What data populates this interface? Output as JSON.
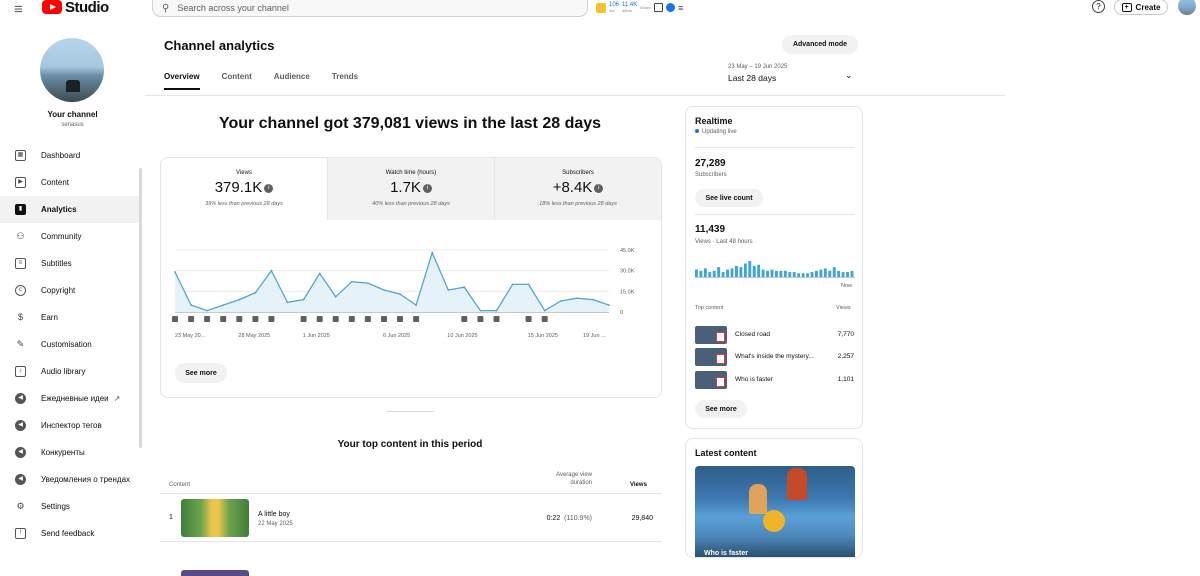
{
  "topbar": {
    "logo_text": "Studio",
    "search_placeholder": "Search across your channel",
    "ext_stat1": "106",
    "ext_stat1_sub": "1hr",
    "ext_stat2": "11.4K",
    "ext_stat2_sub": "48hrs",
    "ext_stat3_sub": "60sec",
    "create_label": "Create"
  },
  "sidebar": {
    "channel_name": "Your channel",
    "channel_handle": "senasus",
    "items": [
      {
        "label": "Dashboard",
        "icon": "dashboard-icon"
      },
      {
        "label": "Content",
        "icon": "content-icon"
      },
      {
        "label": "Analytics",
        "icon": "analytics-icon"
      },
      {
        "label": "Community",
        "icon": "community-icon"
      },
      {
        "label": "Subtitles",
        "icon": "subtitles-icon"
      },
      {
        "label": "Copyright",
        "icon": "copyright-icon"
      },
      {
        "label": "Earn",
        "icon": "earn-icon"
      },
      {
        "label": "Customisation",
        "icon": "customisation-icon"
      },
      {
        "label": "Audio library",
        "icon": "audio-library-icon"
      },
      {
        "label": "Ежедневные идеи",
        "icon": "extension-icon"
      },
      {
        "label": "Инспектор тегов",
        "icon": "extension-icon"
      },
      {
        "label": "Конкуренты",
        "icon": "extension-icon"
      },
      {
        "label": "Уведомления о трендах",
        "icon": "extension-icon"
      },
      {
        "label": "Settings",
        "icon": "settings-icon"
      },
      {
        "label": "Send feedback",
        "icon": "feedback-icon"
      }
    ]
  },
  "header": {
    "title": "Channel analytics",
    "advanced_mode": "Advanced mode",
    "tabs": [
      "Overview",
      "Content",
      "Audience",
      "Trends"
    ],
    "date_range": "23 May – 19 Jun 2025",
    "period": "Last 28 days"
  },
  "overview": {
    "headline": "Your channel got 379,081 views in the last 28 days",
    "metrics": [
      {
        "label": "Views",
        "value": "379.1K",
        "note": "39% less than previous 28 days"
      },
      {
        "label": "Watch time (hours)",
        "value": "1.7K",
        "note": "40% less than previous 28 days"
      },
      {
        "label": "Subscribers",
        "value": "+8.4K",
        "note": "18% less than previous 28 days"
      }
    ],
    "see_more": "See more"
  },
  "chart_data": {
    "type": "area",
    "x": [
      "23 May",
      "24 May",
      "25 May",
      "26 May",
      "27 May",
      "28 May",
      "29 May",
      "30 May",
      "31 May",
      "1 Jun",
      "2 Jun",
      "3 Jun",
      "4 Jun",
      "5 Jun",
      "6 Jun",
      "7 Jun",
      "8 Jun",
      "9 Jun",
      "10 Jun",
      "11 Jun",
      "12 Jun",
      "13 Jun",
      "14 Jun",
      "15 Jun",
      "16 Jun",
      "17 Jun",
      "18 Jun",
      "19 Jun"
    ],
    "values": [
      29000,
      5000,
      1000,
      5000,
      9000,
      14000,
      30000,
      7000,
      9000,
      28000,
      11000,
      22000,
      21000,
      16000,
      13000,
      5000,
      43000,
      16000,
      18000,
      1000,
      1000,
      20000,
      20000,
      1000,
      8000,
      10000,
      9000,
      5000
    ],
    "x_tick_labels": [
      "23 May 20...",
      "28 May 2025",
      "1 Jun 2025",
      "6 Jun 2025",
      "10 Jun 2025",
      "15 Jun 2025",
      "19 Jun ..."
    ],
    "y_tick_labels": [
      "45.0K",
      "30.0K",
      "15.0K",
      "0"
    ],
    "ylim": [
      0,
      45000
    ],
    "line_color": "#54a5d0",
    "fill_color": "#e6f2f9",
    "upload_markers": [
      "23 May",
      "24 May",
      "25 May",
      "26 May",
      "27 May",
      "28 May",
      "29 May",
      "31 May",
      "1 Jun",
      "2 Jun",
      "3 Jun",
      "4 Jun",
      "5 Jun",
      "6 Jun",
      "7 Jun",
      "10 Jun",
      "11 Jun",
      "12 Jun",
      "14 Jun",
      "15 Jun"
    ]
  },
  "top_content": {
    "title": "Your top content in this period",
    "col_content": "Content",
    "col_avg_duration": "Average view duration",
    "col_views": "Views",
    "rows": [
      {
        "rank": "1",
        "title": "A little boy",
        "date": "22 May 2025",
        "duration": "0:22",
        "duration_pct": "(110.9%)",
        "views": "29,840"
      }
    ]
  },
  "realtime": {
    "title": "Realtime",
    "live": "Updating live",
    "subscribers": "27,289",
    "subscribers_label": "Subscribers",
    "see_live_count": "See live count",
    "views": "11,439",
    "views_label": "Views · Last 48 hours",
    "now_label": "Now",
    "bars": [
      6,
      5,
      7,
      4,
      5,
      8,
      4,
      6,
      7,
      9,
      8,
      11,
      13,
      9,
      10,
      6,
      5,
      6,
      5,
      5,
      5,
      4,
      4,
      3,
      3,
      3,
      4,
      5,
      6,
      7,
      5,
      8,
      5,
      4,
      4,
      5
    ],
    "top_content_label": "Top content",
    "views_col": "Views",
    "items": [
      {
        "name": "Closed road",
        "views": "7,770"
      },
      {
        "name": "What's inside the mystery...",
        "views": "2,257"
      },
      {
        "name": "Who is faster",
        "views": "1,101"
      }
    ],
    "see_more": "See more"
  },
  "latest": {
    "title": "Latest content",
    "caption": "Who is faster"
  }
}
